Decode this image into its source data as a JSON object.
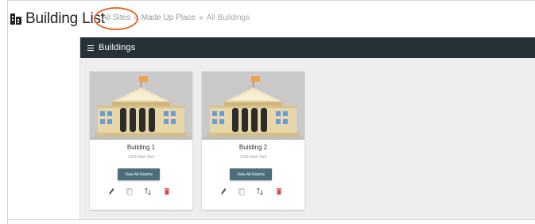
{
  "page": {
    "title": "Building List",
    "title_icon": "building-icon"
  },
  "breadcrumb": {
    "items": [
      {
        "label": "All Sites",
        "link": true
      },
      {
        "label": "Made Up Place",
        "link": true
      },
      {
        "label": "All Buildings",
        "link": false
      }
    ],
    "separator": "»",
    "highlight_color": "#e8692c"
  },
  "panel": {
    "header_title": "Buildings",
    "header_bg": "#273238",
    "menu_icon": "hamburger-menu-icon"
  },
  "buildings": [
    {
      "name": "Building 1",
      "address": "1234 New York",
      "view_button": "View All Rooms"
    },
    {
      "name": "Building 2",
      "address": "1234 New York",
      "view_button": "View All Rooms"
    }
  ],
  "card_actions": [
    {
      "icon": "pencil-edit-icon",
      "color": "#555555"
    },
    {
      "icon": "copy-icon",
      "color": "#aaaaaa"
    },
    {
      "icon": "sort-arrows-icon",
      "color": "#555555"
    },
    {
      "icon": "trash-delete-icon",
      "color": "#e04848"
    }
  ]
}
